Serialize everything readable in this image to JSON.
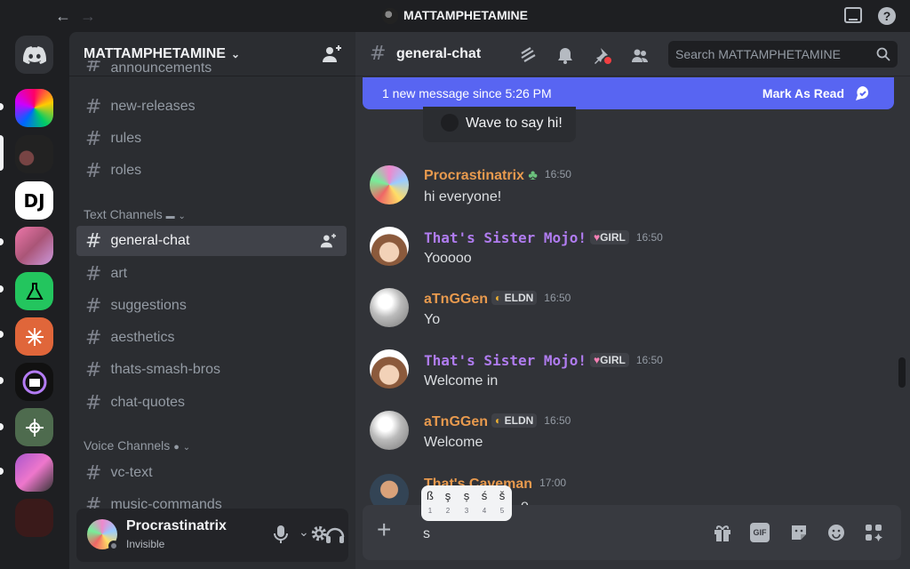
{
  "window": {
    "title": "MATTAMPHETAMINE"
  },
  "server": {
    "name": "MATTAMPHETAMINE"
  },
  "channels_top": [
    "announcements",
    "new-releases",
    "rules",
    "roles"
  ],
  "categories": {
    "text": "Text Channels",
    "voice": "Voice Channels"
  },
  "text_channels": [
    "general-chat",
    "art",
    "suggestions",
    "aesthetics",
    "thats-smash-bros",
    "chat-quotes"
  ],
  "voice_channels": [
    "vc-text",
    "music-commands"
  ],
  "user": {
    "name": "Procrastinatrix",
    "status": "Invisible"
  },
  "channel_header": {
    "name": "general-chat",
    "search_placeholder": "Search MATTAMPHETAMINE"
  },
  "banner": {
    "text": "1 new message since 5:26 PM",
    "action": "Mark As Read"
  },
  "wave": {
    "label": "Wave to say hi!"
  },
  "messages": [
    {
      "author": "Procrastinatrix",
      "tag": "",
      "time": "16:50",
      "text": "hi everyone!",
      "color": "#e89a4e"
    },
    {
      "author": "That's Sister Mojo!",
      "tag": "GIRL",
      "time": "16:50",
      "text": "Yooooo",
      "color": "#b07cf0"
    },
    {
      "author": "aTnGGen",
      "tag": "ELDN",
      "time": "16:50",
      "text": "Yo",
      "color": "#e89a4e"
    },
    {
      "author": "That's Sister Mojo!",
      "tag": "GIRL",
      "time": "16:50",
      "text": "Welcome in",
      "color": "#b07cf0"
    },
    {
      "author": "aTnGGen",
      "tag": "ELDN",
      "time": "16:50",
      "text": "Welcome",
      "color": "#e89a4e"
    },
    {
      "author": "That's Caveman",
      "tag": "",
      "time": "17:00",
      "text": "e",
      "color": "#e89a4e"
    }
  ],
  "composer": {
    "value": "s",
    "gif_label": "GIF"
  },
  "char_picker": {
    "options": [
      "ß",
      "ş",
      "ș",
      "ś",
      "š"
    ],
    "numbers": [
      "1",
      "2",
      "3",
      "4",
      "5"
    ]
  },
  "colors": {
    "accent": "#5865f2",
    "online": "#23a55a"
  }
}
